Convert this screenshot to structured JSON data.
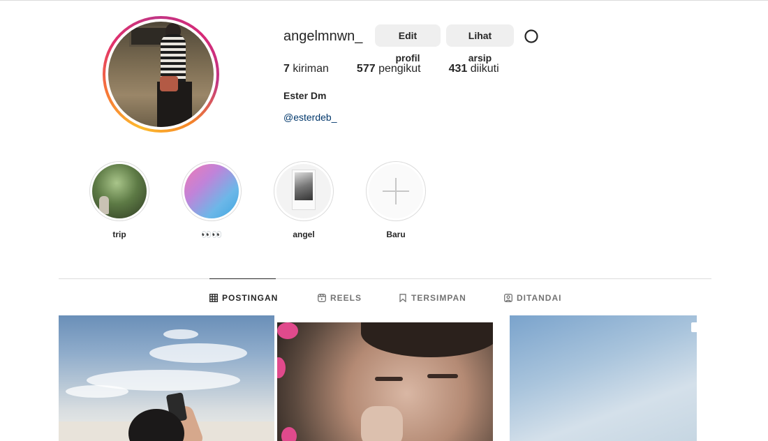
{
  "profile": {
    "username": "angelmnwn_",
    "edit_button": "Edit profil",
    "archive_button": "Lihat arsip",
    "full_name": "Ester Dm",
    "link": "@esterdeb_"
  },
  "stats": {
    "posts_count": "7",
    "posts_label": "kiriman",
    "followers_count": "577",
    "followers_label": "pengikut",
    "following_count": "431",
    "following_label": "diikuti"
  },
  "highlights": [
    {
      "label": "trip"
    },
    {
      "label": "👀👀"
    },
    {
      "label": "angel"
    },
    {
      "label": "Baru"
    }
  ],
  "tabs": [
    {
      "label": "POSTINGAN",
      "icon": "grid-icon"
    },
    {
      "label": "REELS",
      "icon": "reels-icon"
    },
    {
      "label": "TERSIMPAN",
      "icon": "bookmark-icon"
    },
    {
      "label": "DITANDAI",
      "icon": "tagged-icon"
    }
  ],
  "colors": {
    "button_bg": "#efefef",
    "link": "#00376b",
    "divider": "#dbdbdb",
    "text": "#262626",
    "muted": "#737373"
  }
}
